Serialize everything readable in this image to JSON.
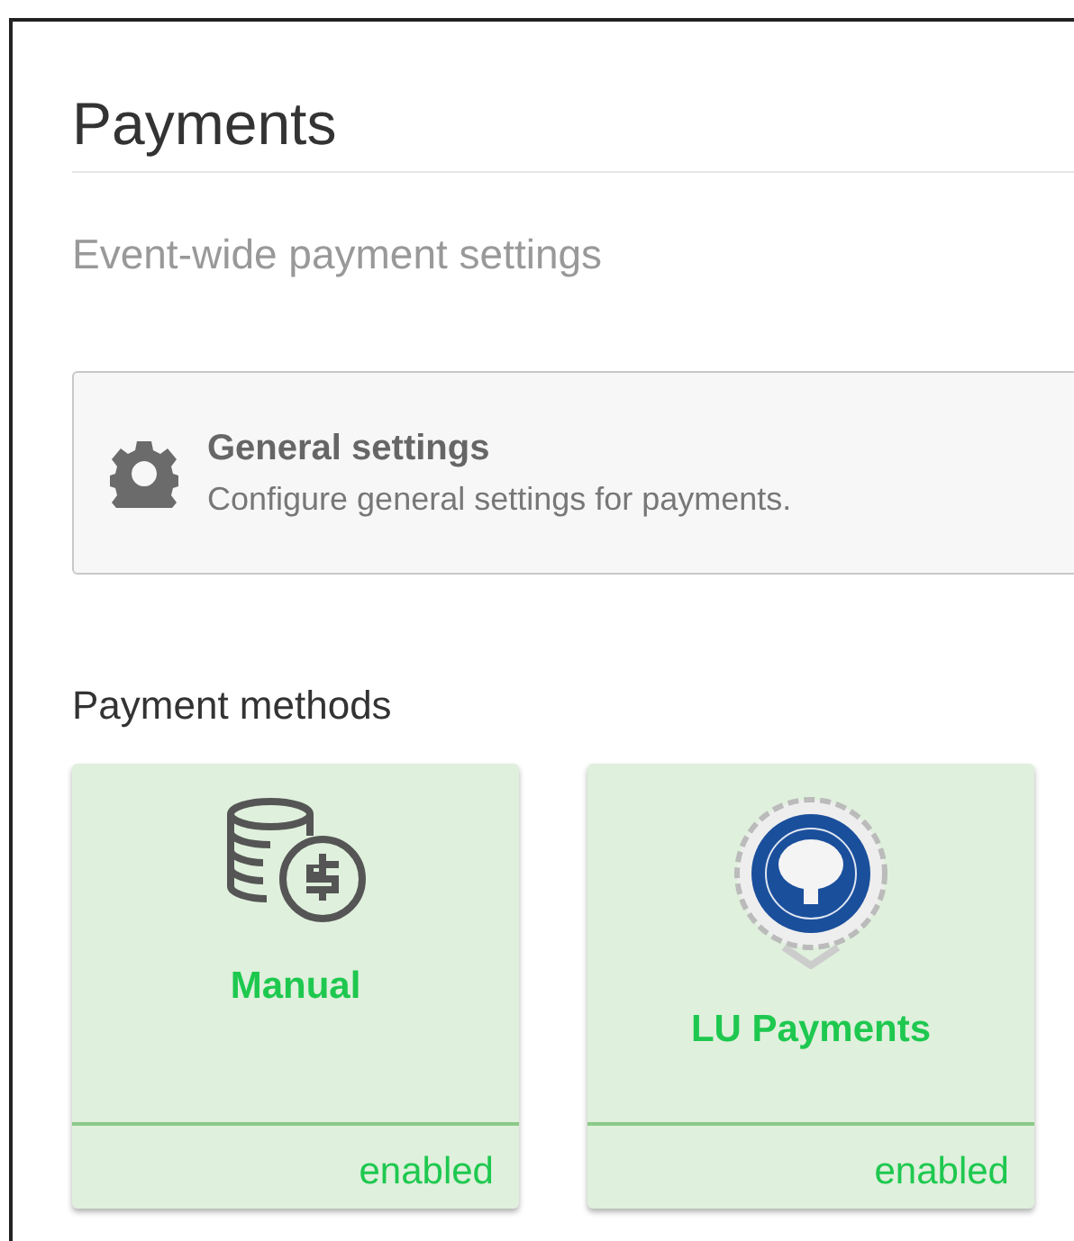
{
  "heading": "Payments",
  "subtitle": "Event-wide payment settings",
  "settings": {
    "title": "General settings",
    "description": "Configure general settings for payments."
  },
  "methods_heading": "Payment methods",
  "methods": [
    {
      "name": "Manual",
      "kind": "coins",
      "enabled": true,
      "status": "enabled"
    },
    {
      "name": "LU Payments",
      "kind": "seal",
      "enabled": true,
      "status": "enabled"
    }
  ]
}
